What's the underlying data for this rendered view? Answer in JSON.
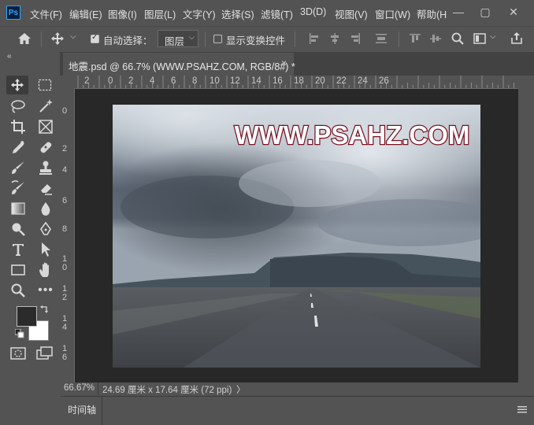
{
  "app": {
    "logo": "Ps",
    "menu": [
      "文件(F)",
      "编辑(E)",
      "图像(I)",
      "图层(L)",
      "文字(Y)",
      "选择(S)",
      "滤镜(T)",
      "3D(D)",
      "视图(V)",
      "窗口(W)",
      "帮助(H"
    ],
    "window_buttons": [
      "—",
      "▢",
      "✕"
    ]
  },
  "options": {
    "auto_select_label": "自动选择：",
    "auto_select_checked": true,
    "target_value": "图层",
    "show_transform_label": "显示变换控件",
    "show_transform_checked": false
  },
  "document": {
    "tab_title": "地震.psd @ 66.7% (WWW.PSAHZ.COM, RGB/8#) *",
    "tab_close": "×",
    "watermark": "WWW.PSAHZ.COM"
  },
  "rulers": {
    "top": [
      "2",
      "0",
      "2",
      "4",
      "6",
      "8",
      "10",
      "12",
      "14",
      "16",
      "18",
      "20",
      "22",
      "24",
      "26"
    ],
    "left": [
      "0",
      "2",
      "4",
      "6",
      "8",
      "10",
      "12",
      "14",
      "16"
    ]
  },
  "status": {
    "zoom": "66.67%",
    "doc_size": "24.69 厘米 x 17.64 厘米 (72 ppi)",
    "arrow": "〉"
  },
  "timeline": {
    "label": "时间轴"
  },
  "colors": {
    "foreground": "#2b2b2b",
    "background": "#ffffff",
    "accent": "#31a8ff",
    "watermark_fill": "#ffffff",
    "watermark_stroke": "#7a1020"
  }
}
